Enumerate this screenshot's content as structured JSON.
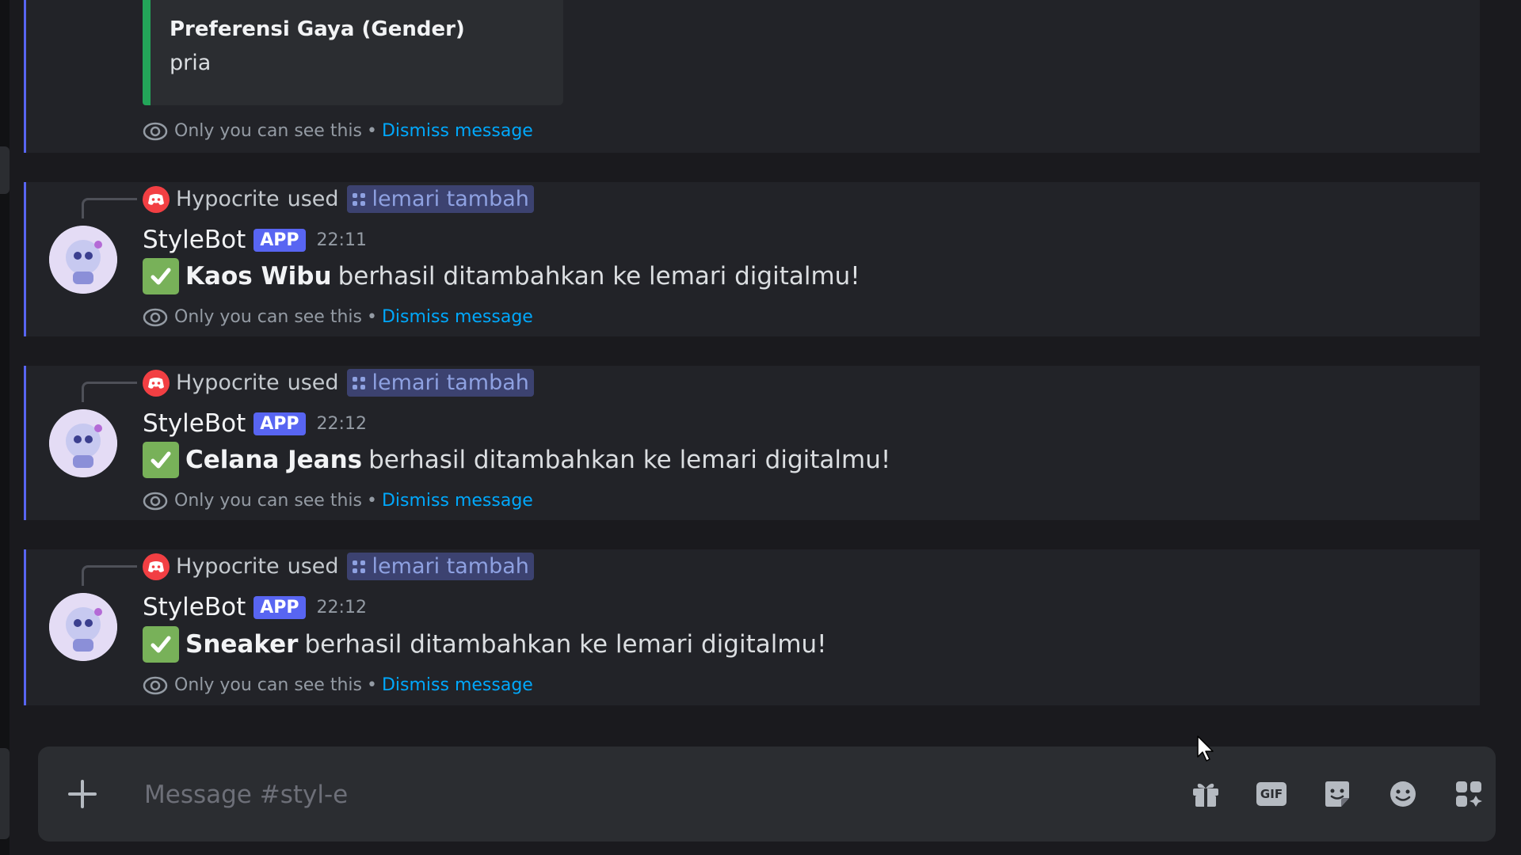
{
  "embed": {
    "field_name": "Preferensi Gaya (Gender)",
    "field_value": "pria"
  },
  "ephemeral": {
    "notice": "Only you can see this",
    "separator": "•",
    "dismiss": "Dismiss message"
  },
  "messages": [
    {
      "invoker": "Hypocrite",
      "used": "used",
      "command": "lemari tambah",
      "author": "StyleBot",
      "badge": "APP",
      "time": "22:11",
      "item": "Kaos Wibu",
      "text": "berhasil ditambahkan ke lemari digitalmu!"
    },
    {
      "invoker": "Hypocrite",
      "used": "used",
      "command": "lemari tambah",
      "author": "StyleBot",
      "badge": "APP",
      "time": "22:12",
      "item": "Celana Jeans",
      "text": "berhasil ditambahkan ke lemari digitalmu!"
    },
    {
      "invoker": "Hypocrite",
      "used": "used",
      "command": "lemari tambah",
      "author": "StyleBot",
      "badge": "APP",
      "time": "22:12",
      "item": "Sneaker",
      "text": "berhasil ditambahkan ke lemari digitalmu!"
    }
  ],
  "composer": {
    "placeholder": "Message #styl-e",
    "gif_label": "GIF"
  },
  "colors": {
    "accent": "#5865f2",
    "link": "#00a8fc",
    "embed_bar": "#23a559",
    "check": "#78b159"
  },
  "icons": [
    "eye-icon",
    "discord-icon",
    "apps-icon",
    "check-icon",
    "plus-icon",
    "gift-icon",
    "gif-icon",
    "sticker-icon",
    "emoji-icon",
    "app-launcher-icon",
    "cursor-icon"
  ]
}
